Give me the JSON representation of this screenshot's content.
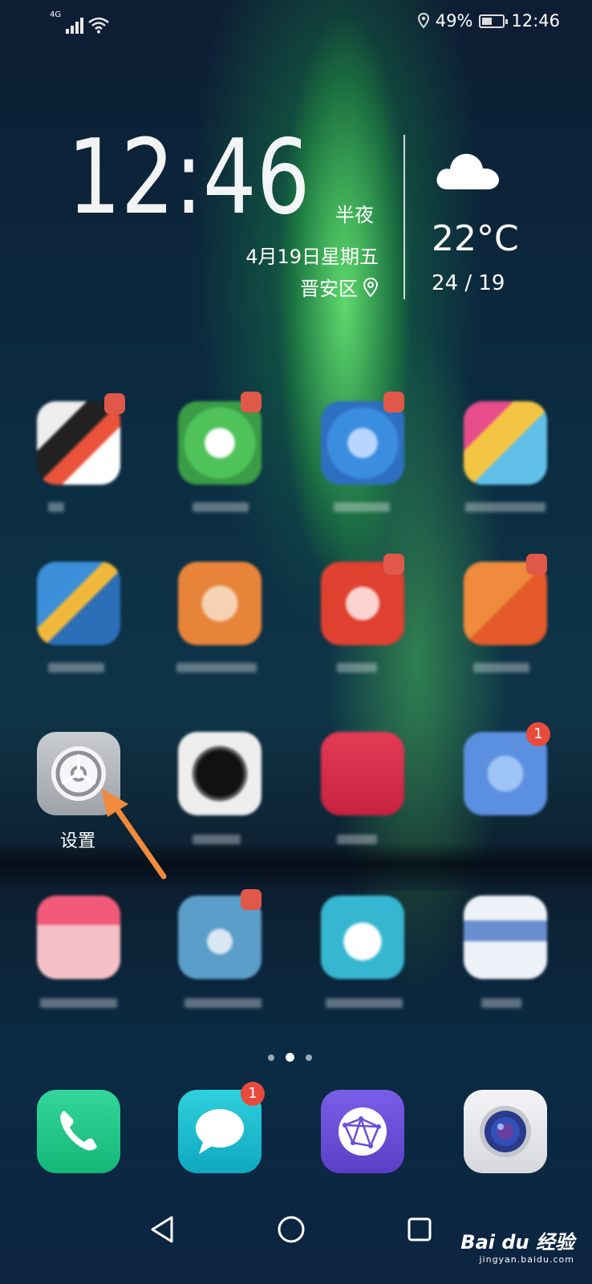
{
  "status_bar": {
    "network": "4G",
    "battery_text": "49%",
    "battery_level": 0.49,
    "time": "12:46",
    "icons": [
      "signal-icon",
      "wifi-icon",
      "location-icon",
      "battery-icon"
    ]
  },
  "clock_widget": {
    "time": "12:46",
    "period": "半夜",
    "date": "4月19日星期五",
    "location": "晋安区"
  },
  "weather_widget": {
    "icon": "cloud-icon",
    "temperature": "22°C",
    "range": "24 / 19"
  },
  "home_grid": {
    "settings_label": "设置"
  },
  "page_indicator": {
    "count": 3,
    "active_index": 1
  },
  "dock": {
    "apps": [
      "phone-icon",
      "messages-icon",
      "browser-icon",
      "camera-icon"
    ],
    "messages_badge": "1"
  },
  "watermark": {
    "brand": "Bai du 经验",
    "url": "jingyan.baidu.com"
  },
  "colors": {
    "badge_red": "#e84b3c",
    "arrow_orange": "#f08a3c",
    "phone_green": "#1fc98a",
    "messages_teal": "#14b8c8",
    "browser_purple": "#6a4fd8"
  },
  "grid_badges": {
    "row3_col4": "1"
  }
}
